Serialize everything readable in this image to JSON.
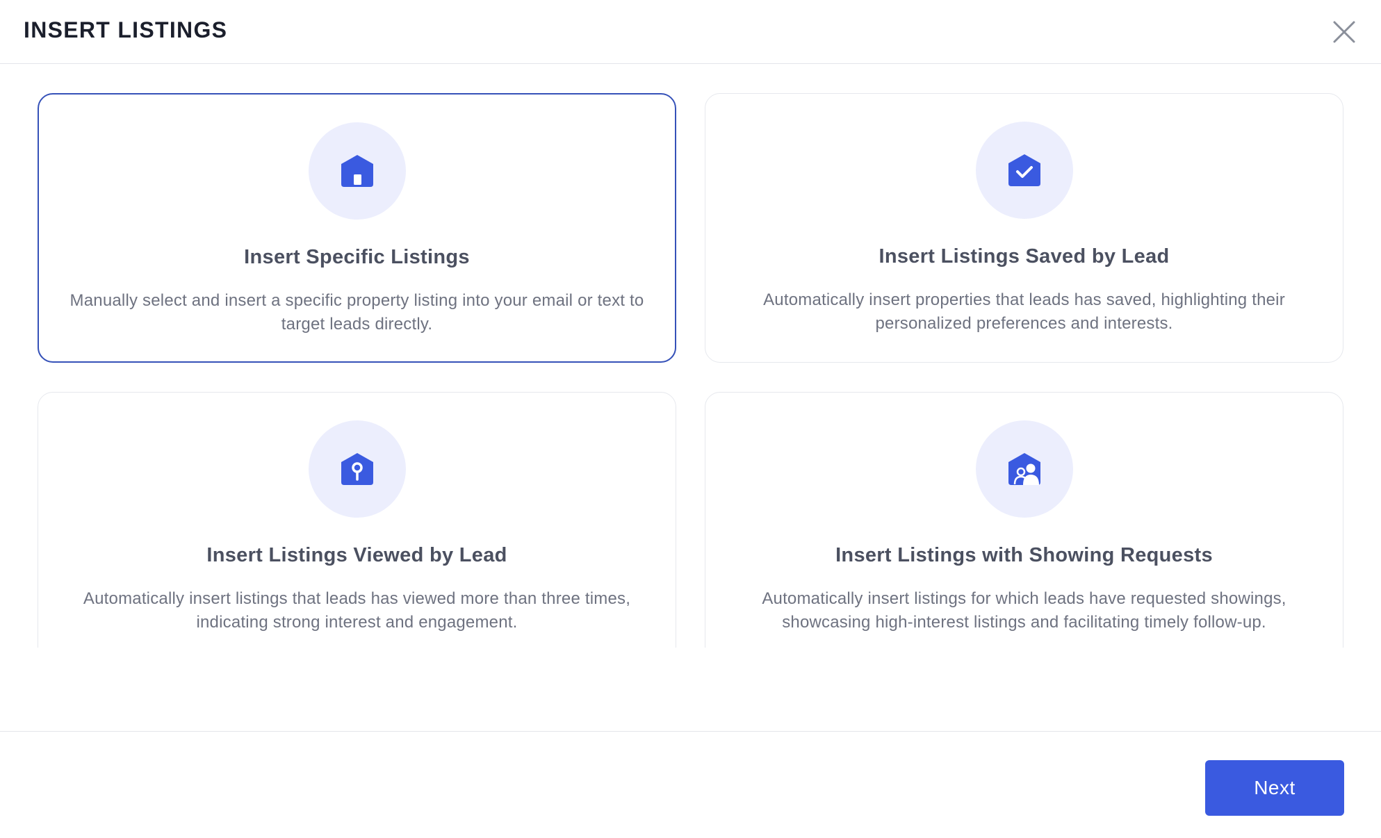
{
  "header": {
    "title": "INSERT LISTINGS",
    "close_icon": "close-icon"
  },
  "colors": {
    "accent": "#3a5ae0",
    "selected_border": "#3551b8",
    "icon_background": "#eceefd"
  },
  "options": [
    {
      "title": "Insert Specific Listings",
      "description": "Manually select and insert a specific property listing into your email or text to target leads directly.",
      "icon": "house-icon",
      "selected": true
    },
    {
      "title": "Insert Listings Saved by Lead",
      "description": "Automatically insert properties that leads has saved, highlighting their personalized preferences and interests.",
      "icon": "house-check-icon",
      "selected": false
    },
    {
      "title": "Insert Listings Viewed by Lead",
      "description": "Automatically insert listings that leads has viewed more than three times, indicating strong interest and engagement.",
      "icon": "house-key-icon",
      "selected": false
    },
    {
      "title": "Insert Listings with Showing Requests",
      "description": "Automatically insert listings for which leads have requested showings, showcasing high-interest listings and facilitating timely follow-up.",
      "icon": "house-people-icon",
      "selected": false
    }
  ],
  "footer": {
    "next_label": "Next"
  }
}
